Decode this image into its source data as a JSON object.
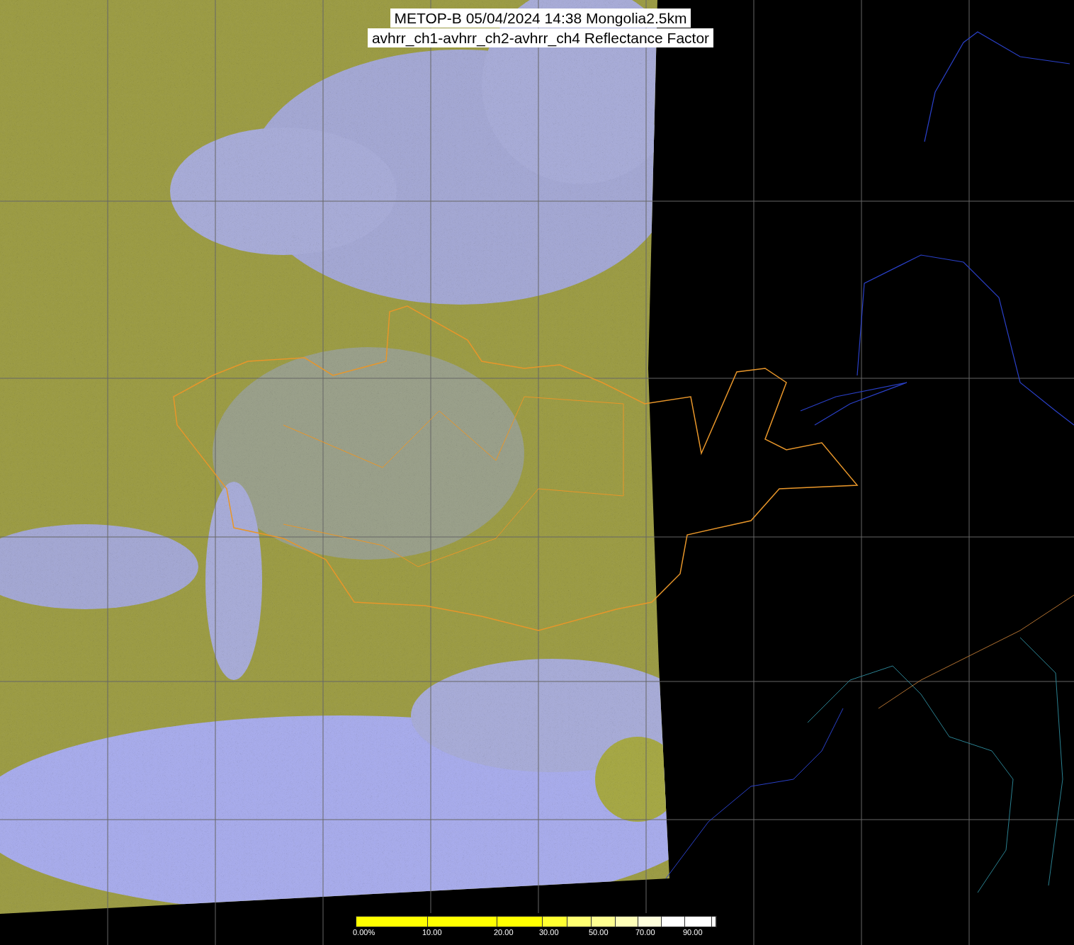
{
  "title_lines": [
    "METOP-B 05/04/2024 14:38 Mongolia2.5km",
    "avhrr_ch1-avhrr_ch2-avhrr_ch4 Reflectance Factor"
  ],
  "colorbar": {
    "tick_labels": [
      "0.00%",
      "10.00",
      "20.00",
      "30.00",
      "50.00",
      "70.00",
      "90.00"
    ]
  }
}
